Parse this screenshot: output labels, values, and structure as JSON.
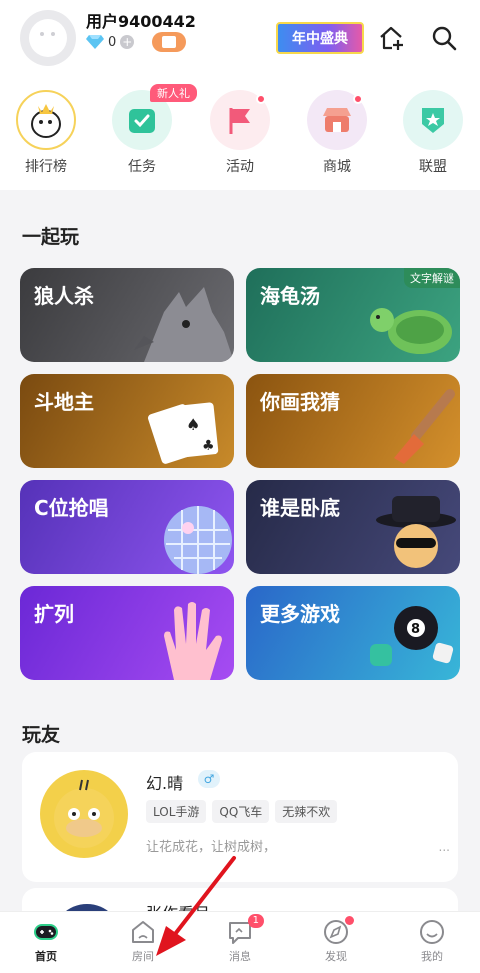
{
  "header": {
    "username": "用户9400442",
    "diamond_count": "0",
    "promo_label": "年中盛典"
  },
  "shortcuts": [
    {
      "label": "排行榜",
      "icon": "ranking-icon"
    },
    {
      "label": "任务",
      "icon": "task-icon",
      "badge": "新人礼"
    },
    {
      "label": "活动",
      "icon": "flag-icon"
    },
    {
      "label": "商城",
      "icon": "shop-icon"
    },
    {
      "label": "联盟",
      "icon": "league-icon"
    }
  ],
  "play": {
    "title": "一起玩",
    "games": [
      {
        "label": "狼人杀"
      },
      {
        "label": "海龟汤",
        "tag": "文字解谜"
      },
      {
        "label": "斗地主"
      },
      {
        "label": "你画我猜"
      },
      {
        "label": "C位抢唱"
      },
      {
        "label": "谁是卧底"
      },
      {
        "label": "扩列"
      },
      {
        "label": "更多游戏"
      }
    ]
  },
  "friends": {
    "title": "玩友",
    "list": [
      {
        "name": "幻.晴",
        "gender": "♂",
        "tags": [
          "LOL手游",
          "QQ飞车",
          "无辣不欢"
        ],
        "bio": "让花成花，让树成树，",
        "more": "..."
      },
      {
        "name": "张作看月"
      }
    ]
  },
  "nav": [
    {
      "label": "首页",
      "active": true
    },
    {
      "label": "房间"
    },
    {
      "label": "消息",
      "badge": "1"
    },
    {
      "label": "发现"
    },
    {
      "label": "我的"
    }
  ],
  "colors": {
    "accent": "#2ecf8a",
    "badge_red": "#ff4f6a"
  }
}
